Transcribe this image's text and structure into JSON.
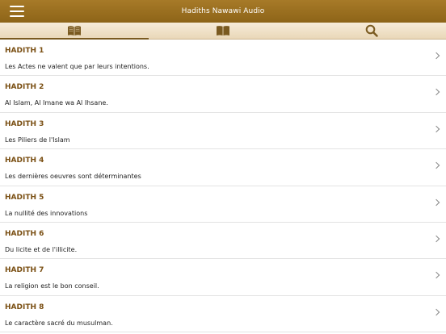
{
  "header": {
    "title": "Hadiths Nawawi Audio",
    "menu_icon": "hamburger-menu-icon",
    "bar_color": "#9a6e20"
  },
  "tabs": [
    {
      "icon": "open-book-icon",
      "active": true
    },
    {
      "icon": "book-icon",
      "active": false
    },
    {
      "icon": "search-icon",
      "active": false
    }
  ],
  "hadiths": [
    {
      "title": "HADITH 1",
      "subtitle": "Les Actes ne valent que par leurs intentions."
    },
    {
      "title": "HADITH 2",
      "subtitle": "Al Islam, Al Imane wa Al Ihsane."
    },
    {
      "title": "HADITH 3",
      "subtitle": "Les Piliers de l'Islam"
    },
    {
      "title": "HADITH 4",
      "subtitle": "Les dernières oeuvres sont déterminantes"
    },
    {
      "title": "HADITH 5",
      "subtitle": "La nullité des innovations"
    },
    {
      "title": "HADITH 6",
      "subtitle": "Du licite et de l'illicite."
    },
    {
      "title": "HADITH 7",
      "subtitle": "La religion est le bon conseil."
    },
    {
      "title": "HADITH 8",
      "subtitle": "Le caractère sacré du musulman."
    }
  ]
}
